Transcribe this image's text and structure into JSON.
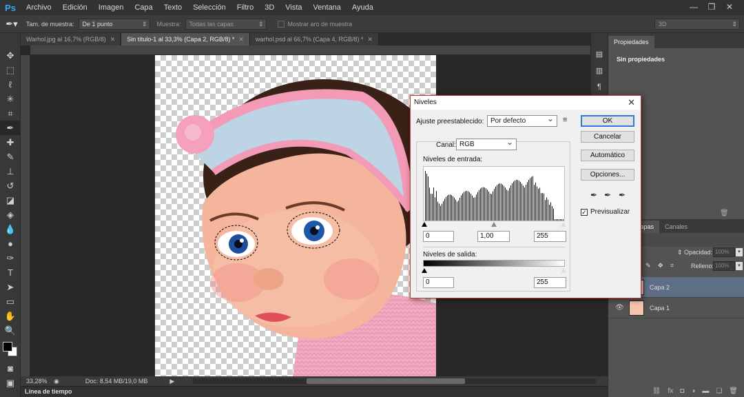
{
  "menu": {
    "logo": "Ps",
    "items": [
      "Archivo",
      "Edición",
      "Imagen",
      "Capa",
      "Texto",
      "Selección",
      "Filtro",
      "3D",
      "Vista",
      "Ventana",
      "Ayuda"
    ]
  },
  "window_controls": {
    "minimize": "—",
    "restore": "❐",
    "close": "✕"
  },
  "options_bar": {
    "sample_size_label": "Tam. de muestra:",
    "sample_size_value": "De 1 punto",
    "sample_label": "Muestra:",
    "sample_value": "Todas las capas",
    "show_ring_label": "Mostrar aro de muestra",
    "workspace_value": "3D"
  },
  "tabs": [
    {
      "label": "Warhol.jpg al 16,7% (RGB/8)",
      "close": "✕"
    },
    {
      "label": "Sin título-1 al 33,3% (Capa 2, RGB/8) *",
      "close": "✕"
    },
    {
      "label": "warhol.psd al 66,7% (Capa 4, RGB/8) *",
      "close": "✕"
    }
  ],
  "status": {
    "zoom": "33,28%",
    "doc": "Doc: 8,54 MB/19,0 MB"
  },
  "timeline_label": "Línea de tiempo",
  "properties": {
    "tab": "Propiedades",
    "content": "Sin propiedades"
  },
  "layers_panel": {
    "tab_layers": "Capas",
    "tab_channels": "Canales",
    "opacity_label": "Opacidad:",
    "opacity_value": "100%",
    "fill_label": "Relleno:",
    "fill_value": "100%",
    "layers": [
      {
        "name": "Capa 2",
        "selected": true
      },
      {
        "name": "Capa 1",
        "selected": false
      }
    ]
  },
  "dialog": {
    "title": "Niveles",
    "close": "✕",
    "preset_label": "Ajuste preestablecido:",
    "preset_value": "Por defecto",
    "channel_label": "Canal:",
    "channel_value": "RGB",
    "input_levels_label": "Niveles de entrada:",
    "input_black": "0",
    "input_gamma": "1,00",
    "input_white": "255",
    "output_levels_label": "Niveles de salida:",
    "output_black": "0",
    "output_white": "255",
    "buttons": {
      "ok": "OK",
      "cancel": "Cancelar",
      "auto": "Automático",
      "options": "Opciones..."
    },
    "preview_label": "Previsualizar",
    "preview_checked": true
  }
}
